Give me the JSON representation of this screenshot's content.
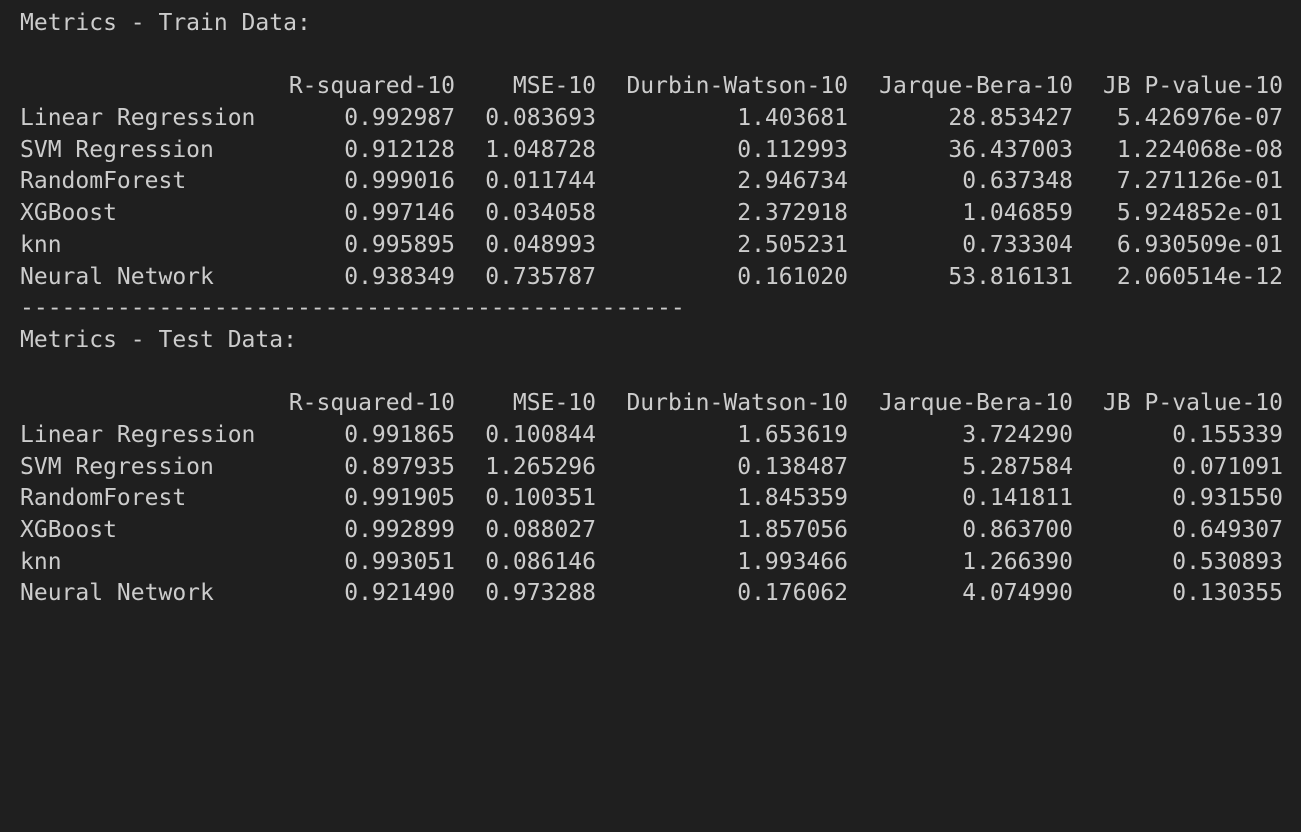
{
  "train": {
    "title": "Metrics - Train Data:",
    "headers": [
      "R-squared-10",
      "MSE-10",
      "Durbin-Watson-10",
      "Jarque-Bera-10",
      "JB P-value-10"
    ],
    "rows": [
      {
        "name": "Linear Regression",
        "values": [
          "0.992987",
          "0.083693",
          "1.403681",
          "28.853427",
          "5.426976e-07"
        ]
      },
      {
        "name": "SVM Regression",
        "values": [
          "0.912128",
          "1.048728",
          "0.112993",
          "36.437003",
          "1.224068e-08"
        ]
      },
      {
        "name": "RandomForest",
        "values": [
          "0.999016",
          "0.011744",
          "2.946734",
          "0.637348",
          "7.271126e-01"
        ]
      },
      {
        "name": "XGBoost",
        "values": [
          "0.997146",
          "0.034058",
          "2.372918",
          "1.046859",
          "5.924852e-01"
        ]
      },
      {
        "name": "knn",
        "values": [
          "0.995895",
          "0.048993",
          "2.505231",
          "0.733304",
          "6.930509e-01"
        ]
      },
      {
        "name": "Neural Network",
        "values": [
          "0.938349",
          "0.735787",
          "0.161020",
          "53.816131",
          "2.060514e-12"
        ]
      }
    ]
  },
  "separator": "------------------------------------------------",
  "test": {
    "title": "Metrics - Test Data:",
    "headers": [
      "R-squared-10",
      "MSE-10",
      "Durbin-Watson-10",
      "Jarque-Bera-10",
      "JB P-value-10"
    ],
    "rows": [
      {
        "name": "Linear Regression",
        "values": [
          "0.991865",
          "0.100844",
          "1.653619",
          "3.724290",
          "0.155339"
        ]
      },
      {
        "name": "SVM Regression",
        "values": [
          "0.897935",
          "1.265296",
          "0.138487",
          "5.287584",
          "0.071091"
        ]
      },
      {
        "name": "RandomForest",
        "values": [
          "0.991905",
          "0.100351",
          "1.845359",
          "0.141811",
          "0.931550"
        ]
      },
      {
        "name": "XGBoost",
        "values": [
          "0.992899",
          "0.088027",
          "1.857056",
          "0.863700",
          "0.649307"
        ]
      },
      {
        "name": "knn",
        "values": [
          "0.993051",
          "0.086146",
          "1.993466",
          "1.266390",
          "0.530893"
        ]
      },
      {
        "name": "Neural Network",
        "values": [
          "0.921490",
          "0.973288",
          "0.176062",
          "4.074990",
          "0.130355"
        ]
      }
    ]
  }
}
